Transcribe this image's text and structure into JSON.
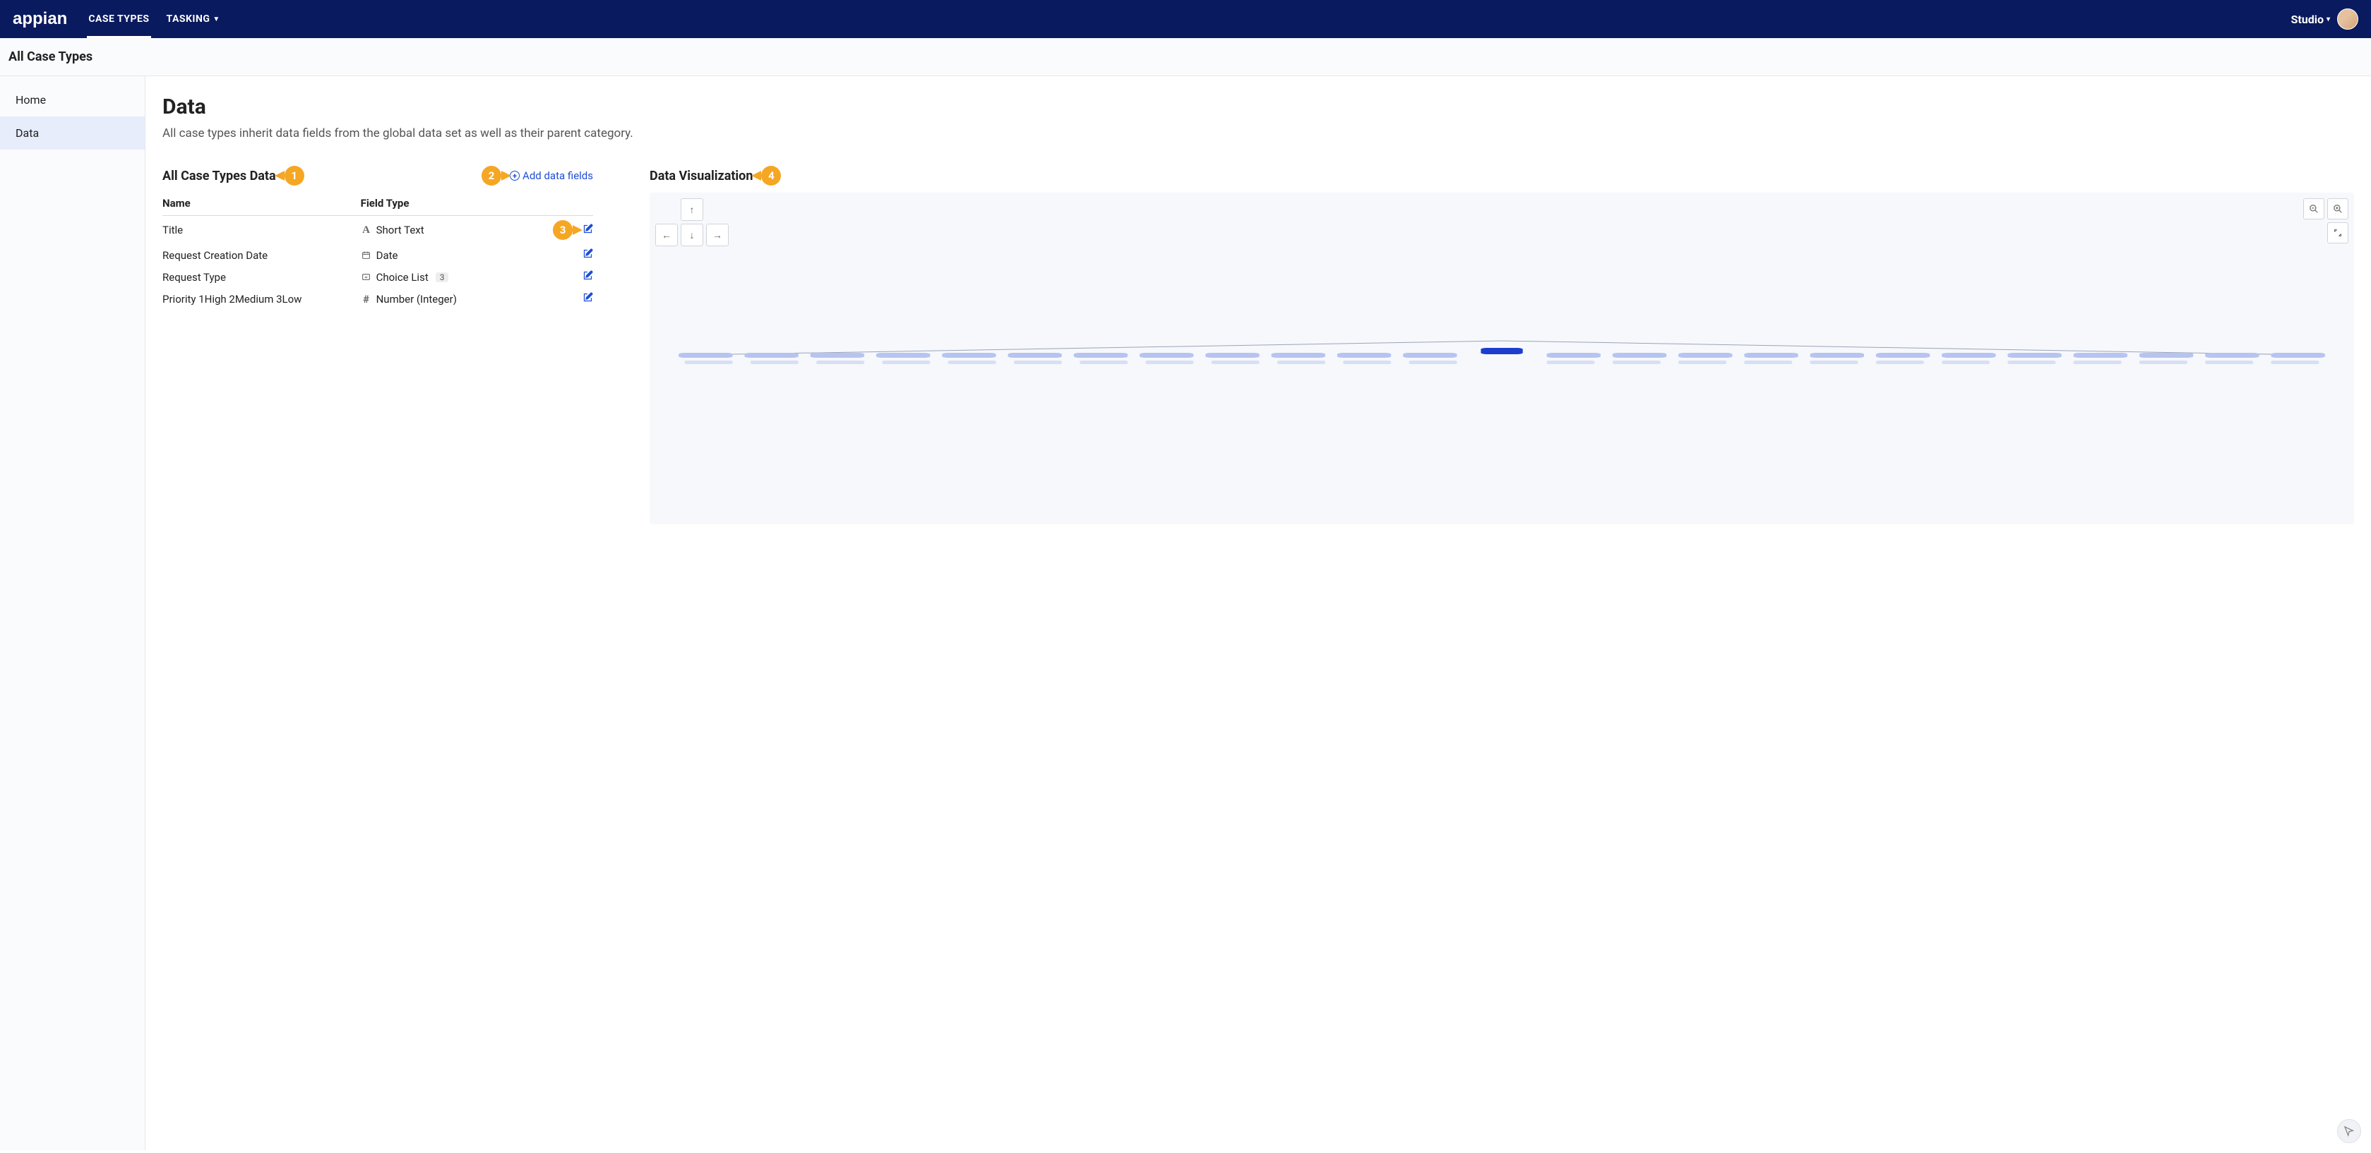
{
  "topbar": {
    "logo_text": "appian",
    "nav": [
      {
        "label": "CASE TYPES",
        "active": true
      },
      {
        "label": "TASKING",
        "active": false,
        "has_dropdown": true
      }
    ],
    "studio_label": "Studio"
  },
  "subheader": {
    "title": "All Case Types"
  },
  "sidebar": {
    "items": [
      {
        "label": "Home",
        "selected": false
      },
      {
        "label": "Data",
        "selected": true
      }
    ]
  },
  "page": {
    "title": "Data",
    "description": "All case types inherit data fields from the global data set as well as their parent category."
  },
  "data_section": {
    "title": "All Case Types Data",
    "add_link": "Add data fields",
    "columns": {
      "name": "Name",
      "field_type": "Field Type"
    },
    "rows": [
      {
        "name": "Title",
        "type_label": "Short Text",
        "type_icon": "A"
      },
      {
        "name": "Request Creation Date",
        "type_label": "Date",
        "type_icon": "calendar"
      },
      {
        "name": "Request Type",
        "type_label": "Choice List",
        "type_icon": "dropdown",
        "count": "3"
      },
      {
        "name": "Priority 1High 2Medium 3Low",
        "type_label": "Number (Integer)",
        "type_icon": "#"
      }
    ]
  },
  "viz_section": {
    "title": "Data Visualization"
  },
  "callouts": {
    "c1": "1",
    "c2": "2",
    "c3": "3",
    "c4": "4"
  }
}
